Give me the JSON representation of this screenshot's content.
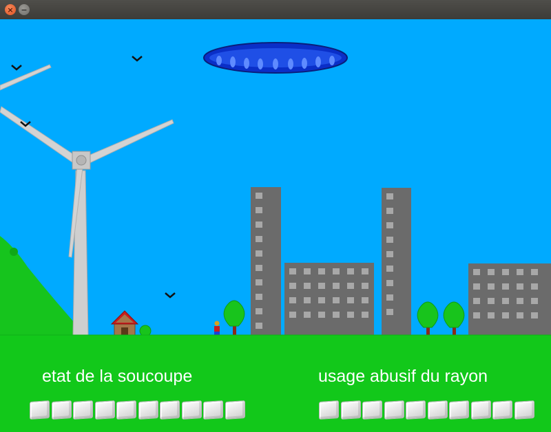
{
  "window": {
    "close_glyph": "×",
    "minimize_glyph": "−"
  },
  "hud": {
    "left_label": "etat de la soucoupe",
    "right_label": "usage abusif du rayon",
    "saucer_state_cells": 10,
    "ray_abuse_cells": 10
  },
  "colors": {
    "sky": "#00aaff",
    "grass": "#12c81a",
    "building": "#6b6b6b",
    "window": "#a8a8a8",
    "saucer": "#0a2fc8",
    "tree": "#18c41c",
    "trunk": "#8b2a1a"
  },
  "icons": [
    "close-icon",
    "minimize-icon",
    "bird-icon",
    "ufo-icon",
    "wind-turbine-icon",
    "house-icon",
    "tree-icon",
    "person-icon",
    "cube-icon"
  ]
}
